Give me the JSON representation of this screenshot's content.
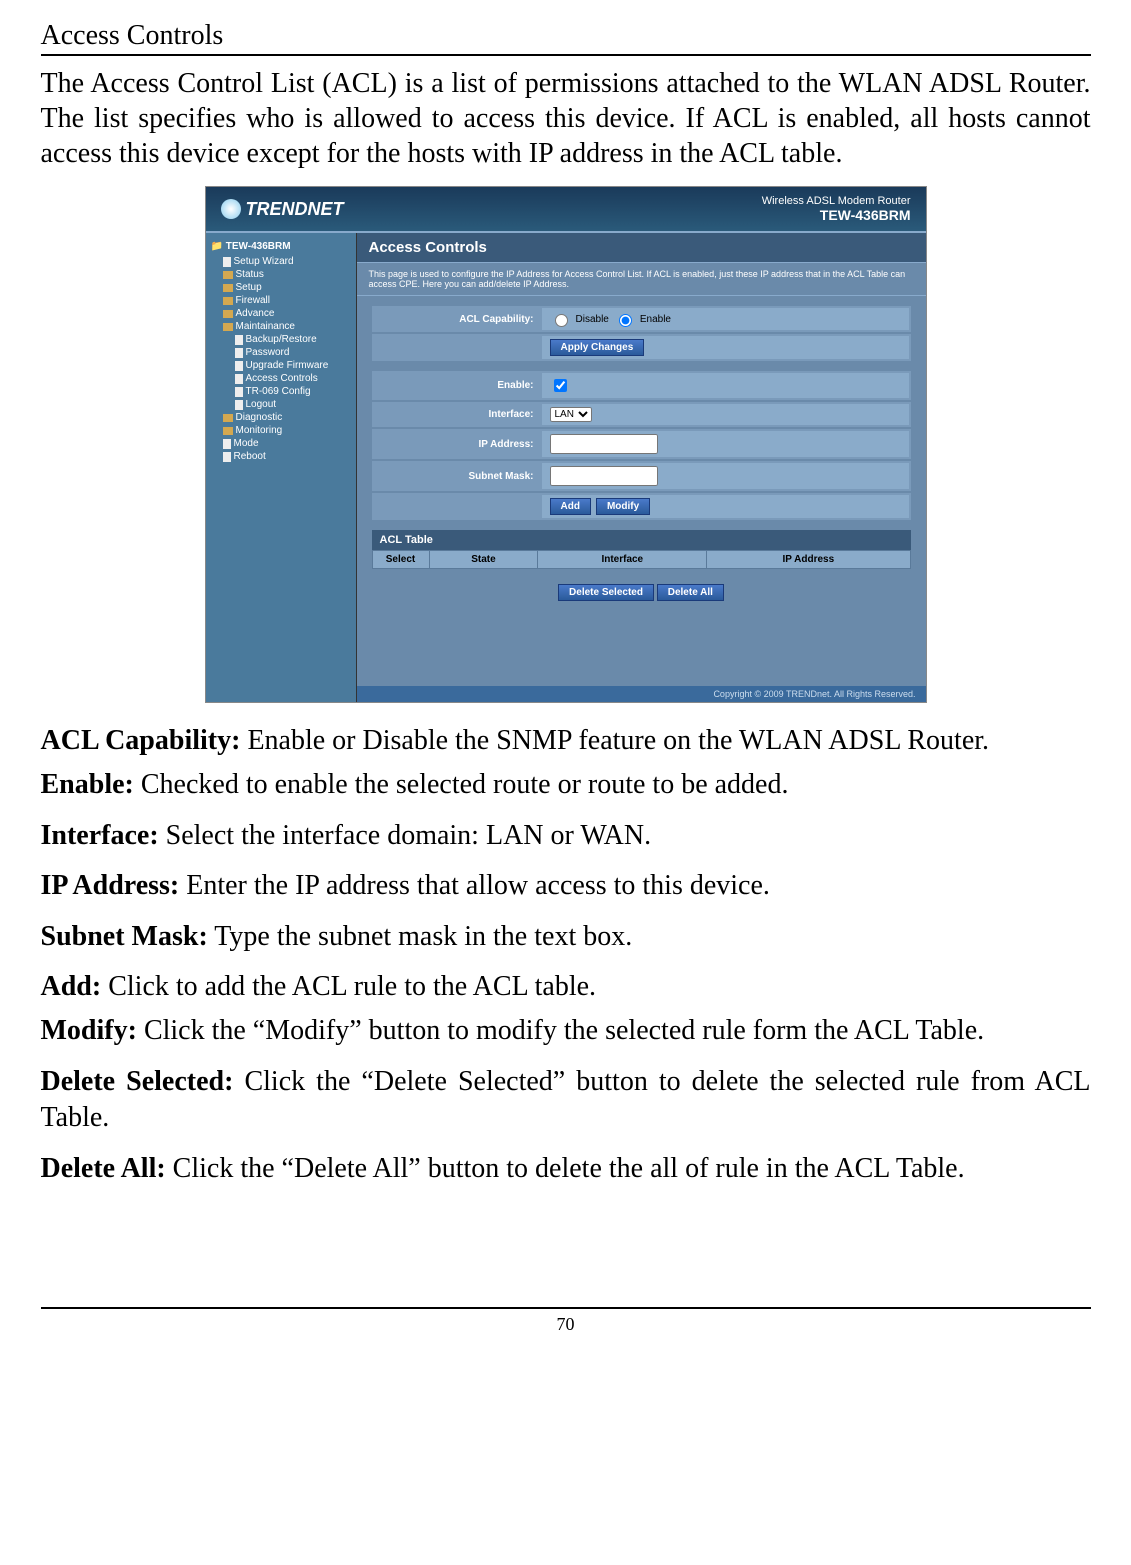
{
  "page": {
    "title": "Access Controls",
    "intro": "The Access Control List (ACL) is a list of permissions attached to the WLAN ADSL Router. The list specifies who is allowed to access this device. If ACL is enabled, all hosts cannot access this device except for the hosts with IP address in the ACL table.",
    "page_number": "70"
  },
  "router_ui": {
    "brand": "TRENDNET",
    "header_line1": "Wireless ADSL Modem Router",
    "header_line2": "TEW-436BRM",
    "sidebar": {
      "root": "TEW-436BRM",
      "items": [
        {
          "label": "Setup Wizard",
          "type": "file"
        },
        {
          "label": "Status",
          "type": "folder"
        },
        {
          "label": "Setup",
          "type": "folder"
        },
        {
          "label": "Firewall",
          "type": "folder"
        },
        {
          "label": "Advance",
          "type": "folder"
        },
        {
          "label": "Maintainance",
          "type": "folder-open",
          "children": [
            {
              "label": "Backup/Restore"
            },
            {
              "label": "Password"
            },
            {
              "label": "Upgrade Firmware"
            },
            {
              "label": "Access Controls"
            },
            {
              "label": "TR-069 Config"
            },
            {
              "label": "Logout"
            }
          ]
        },
        {
          "label": "Diagnostic",
          "type": "folder"
        },
        {
          "label": "Monitoring",
          "type": "folder"
        },
        {
          "label": "Mode",
          "type": "file"
        },
        {
          "label": "Reboot",
          "type": "file"
        }
      ]
    },
    "panel": {
      "title": "Access Controls",
      "description": "This page is used to configure the IP Address for Access Control List. If ACL is enabled, just these IP address that in the ACL Table can access CPE. Here you can add/delete IP Address.",
      "acl_capability_label": "ACL Capability:",
      "disable_label": "Disable",
      "enable_label": "Enable",
      "apply_changes": "Apply Changes",
      "enable_field_label": "Enable:",
      "interface_label": "Interface:",
      "interface_value": "LAN",
      "ip_address_label": "IP Address:",
      "subnet_mask_label": "Subnet Mask:",
      "add_btn": "Add",
      "modify_btn": "Modify",
      "acl_table_title": "ACL Table",
      "table_headers": {
        "select": "Select",
        "state": "State",
        "interface": "Interface",
        "ip_address": "IP Address"
      },
      "delete_selected": "Delete Selected",
      "delete_all": "Delete All"
    },
    "footer": "Copyright © 2009 TRENDnet. All Rights Reserved."
  },
  "definitions": [
    {
      "term": "ACL Capability:",
      "desc": " Enable or Disable the SNMP feature on the WLAN ADSL Router.",
      "spaced": false
    },
    {
      "term": "Enable:",
      "desc": " Checked to enable the selected route or route to be added.",
      "spaced": true
    },
    {
      "term": "Interface:",
      "desc": " Select the interface domain: LAN or WAN.",
      "spaced": true
    },
    {
      "term": "IP Address:",
      "desc": " Enter the IP address that allow access to this device.",
      "spaced": true
    },
    {
      "term": "Subnet Mask:",
      "desc": " Type the subnet mask in the text box.",
      "spaced": true
    },
    {
      "term": "Add:",
      "desc": " Click to add the ACL rule to the ACL table.",
      "spaced": false
    },
    {
      "term": "Modify:",
      "desc": " Click the “Modify” button to modify the selected rule form the ACL Table.",
      "spaced": true
    },
    {
      "term": "Delete Selected:",
      "desc": " Click the “Delete Selected” button to delete the selected rule from ACL Table.",
      "spaced": true
    },
    {
      "term": "Delete All:",
      "desc": " Click the “Delete All” button to delete the all of rule in the ACL Table.",
      "spaced": true
    }
  ]
}
